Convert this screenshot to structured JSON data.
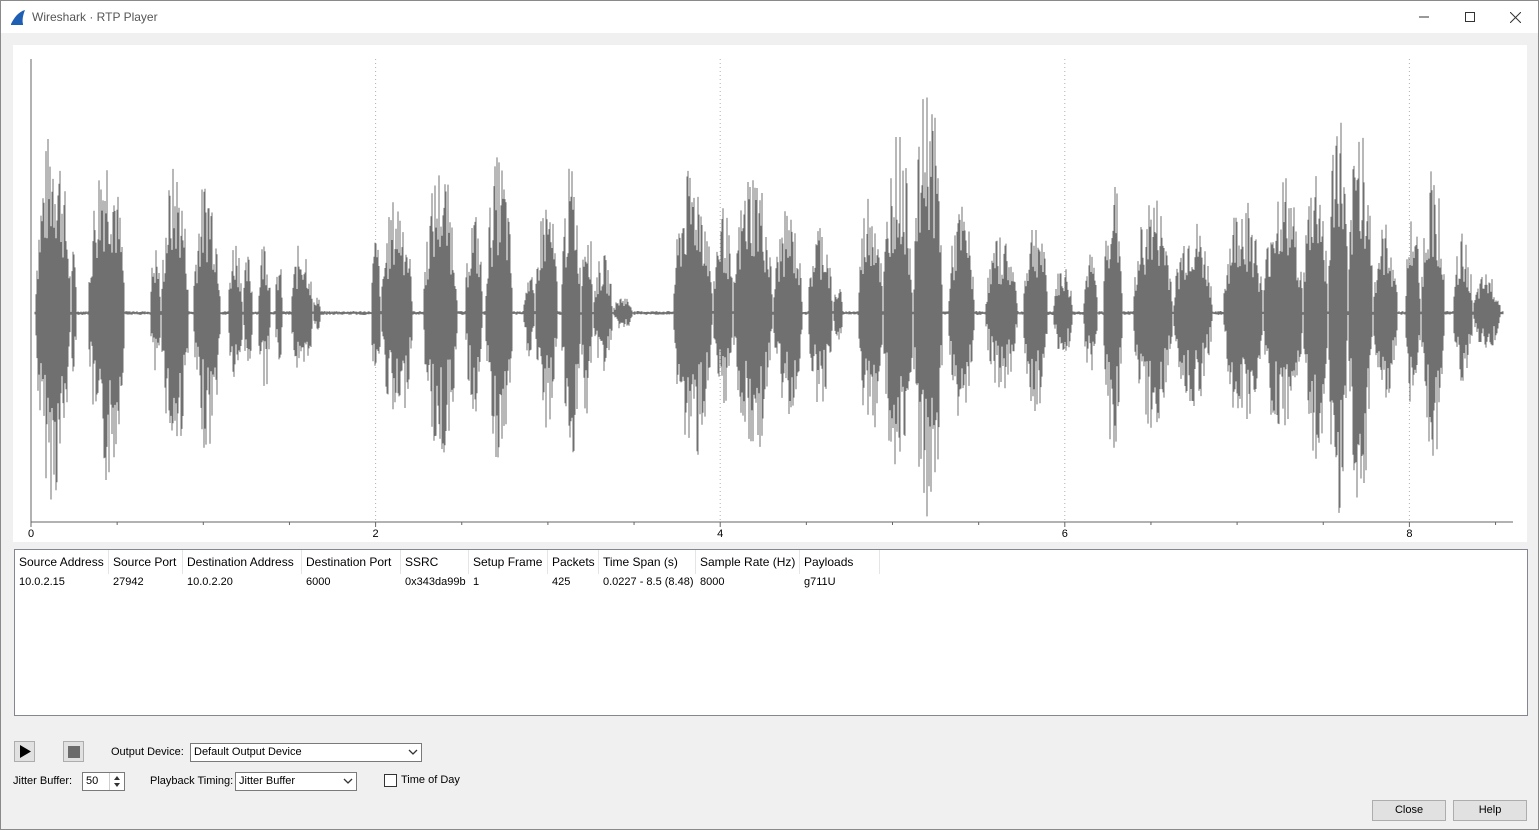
{
  "window": {
    "title": "Wireshark · RTP Player",
    "controls": {
      "minimize": "minimize-icon",
      "maximize": "maximize-icon",
      "close": "close-icon"
    }
  },
  "plot": {
    "x_tick_labels": [
      "0",
      "2",
      "4",
      "6",
      "8"
    ],
    "waveform_color": "#707070"
  },
  "table": {
    "headers": [
      "Source Address",
      "Source Port",
      "Destination Address",
      "Destination Port",
      "SSRC",
      "Setup Frame",
      "Packets",
      "Time Span (s)",
      "Sample Rate (Hz)",
      "Payloads"
    ],
    "rows": [
      [
        "10.0.2.15",
        "27942",
        "10.0.2.20",
        "6000",
        "0x343da99b",
        "1",
        "425",
        "0.0227 - 8.5 (8.48)",
        "8000",
        "g711U"
      ]
    ]
  },
  "controls": {
    "play_icon": "play-icon",
    "stop_icon": "stop-icon",
    "output_device_label": "Output Device:",
    "output_device_value": "Default Output Device",
    "jitter_buffer_label": "Jitter Buffer:",
    "jitter_buffer_value": "50",
    "playback_timing_label": "Playback Timing:",
    "playback_timing_value": "Jitter Buffer",
    "time_of_day_label": "Time of Day",
    "time_of_day_checked": false
  },
  "buttons": {
    "close": "Close",
    "help": "Help"
  }
}
